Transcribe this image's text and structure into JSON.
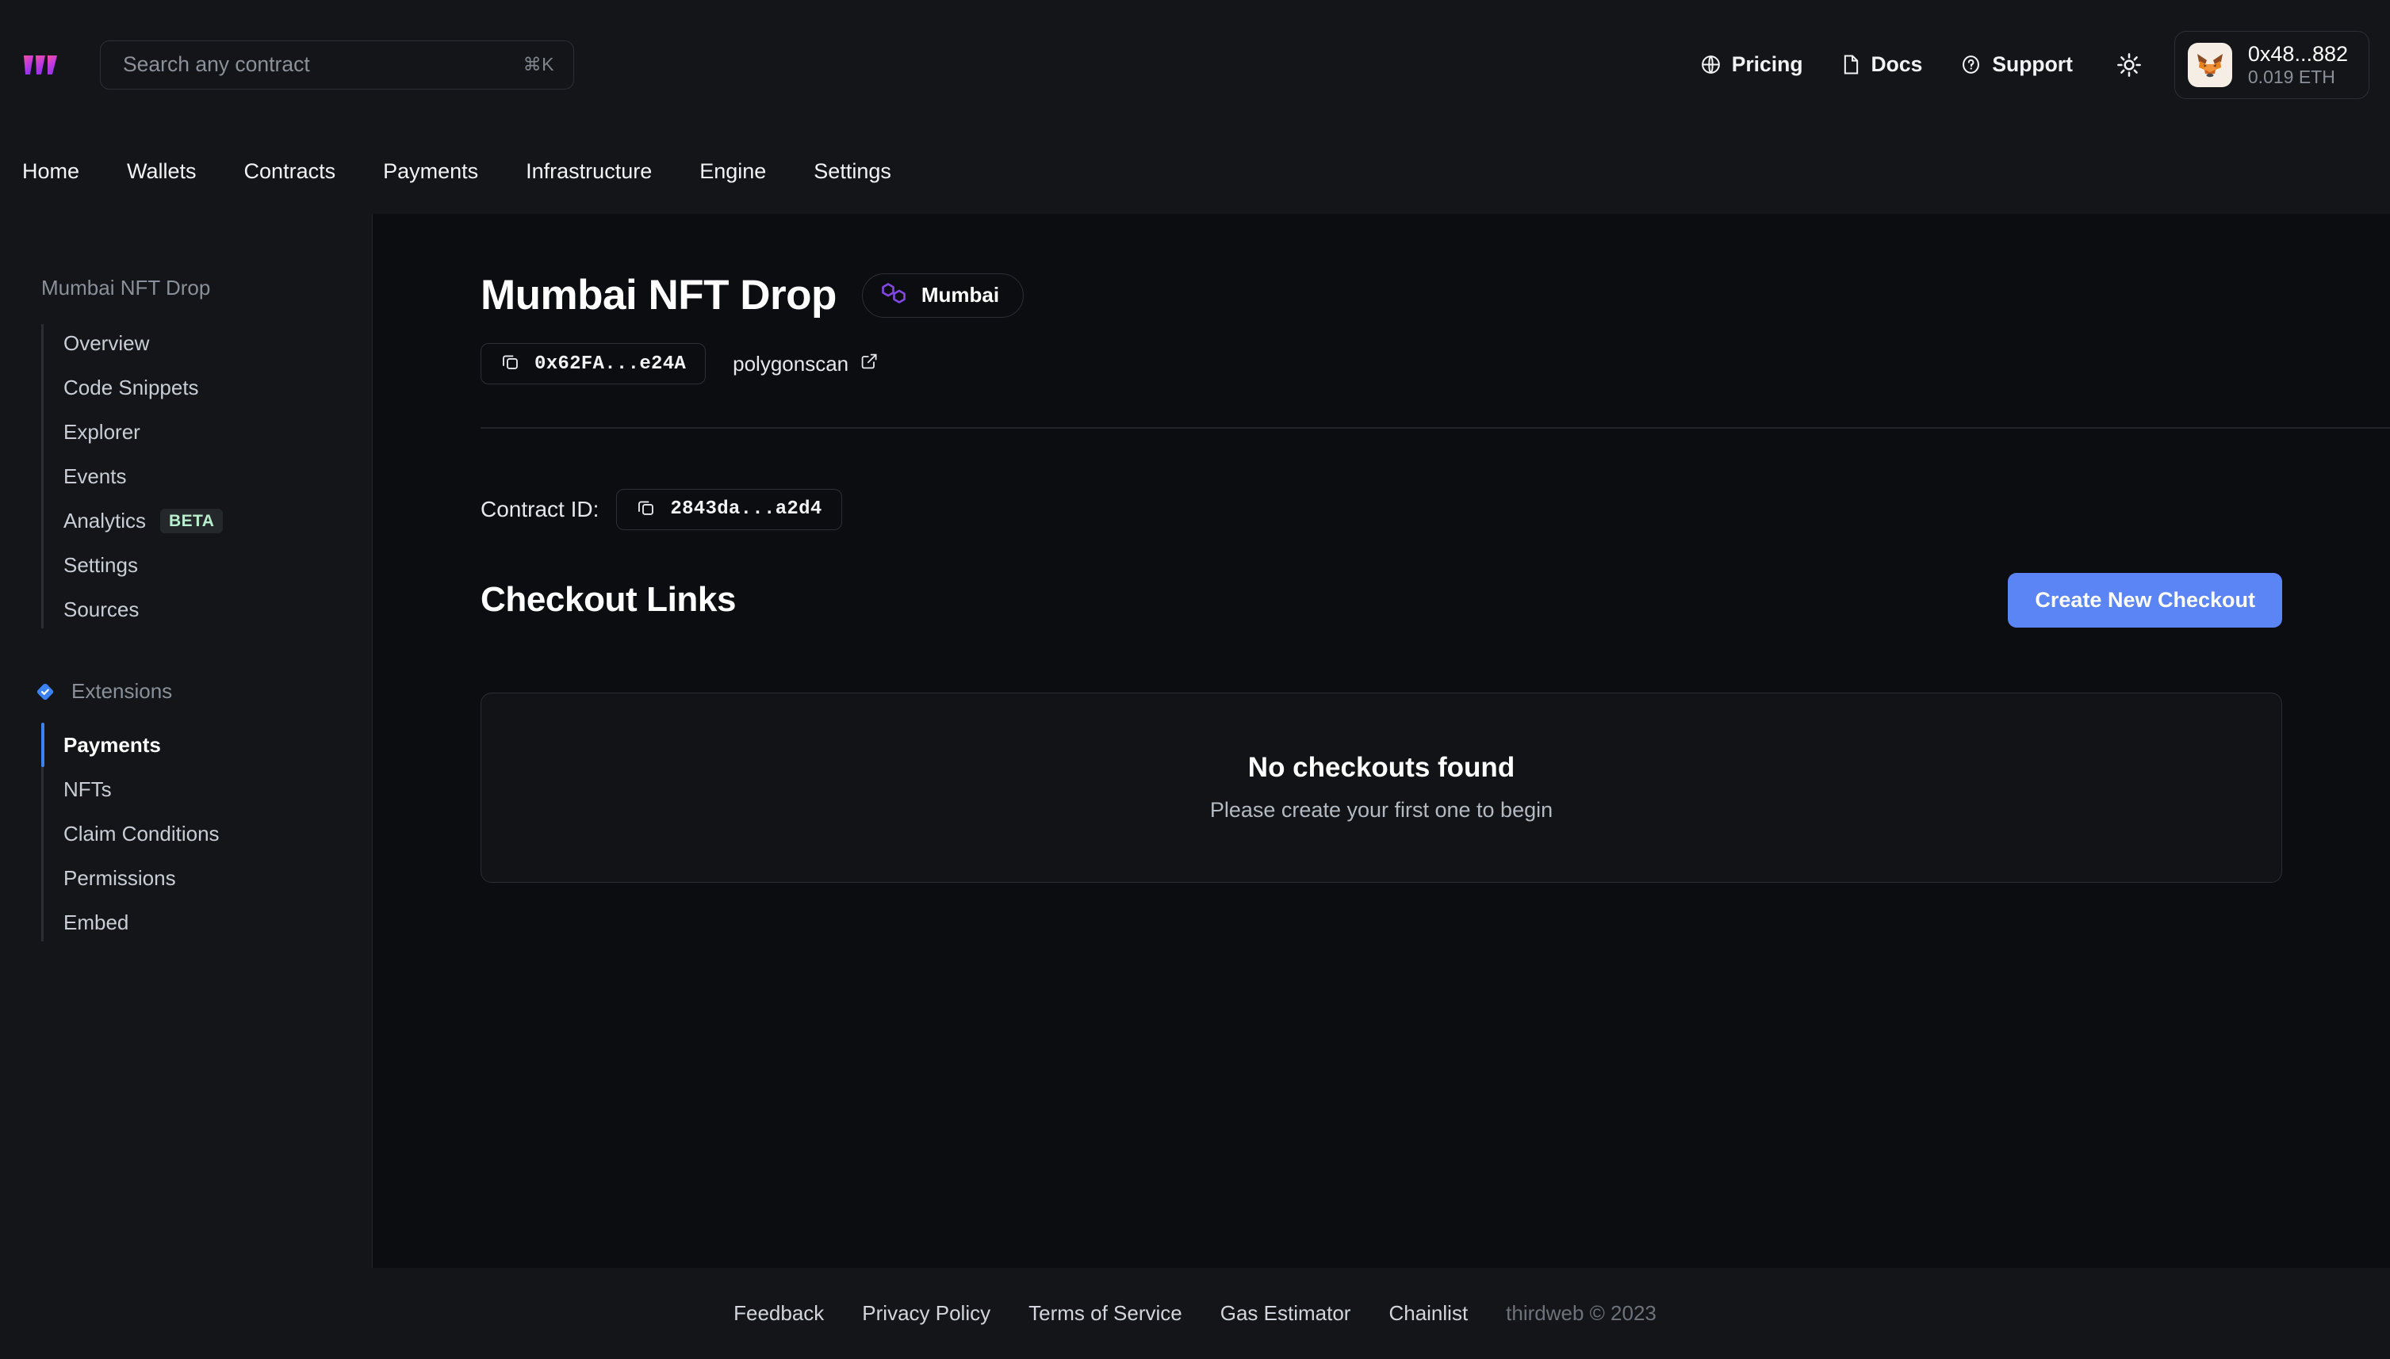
{
  "brand": {
    "logo_name": "thirdweb-logo",
    "accent_purple": "#a855f7",
    "accent_pink": "#e935c1"
  },
  "search": {
    "placeholder": "Search any contract",
    "value": "",
    "shortcut": "⌘K"
  },
  "topbar": {
    "links": [
      {
        "label": "Pricing",
        "icon": "globe-icon"
      },
      {
        "label": "Docs",
        "icon": "file-icon"
      },
      {
        "label": "Support",
        "icon": "question-circle-icon"
      }
    ],
    "theme_toggle_icon": "sun-icon",
    "wallet": {
      "address": "0x48...882",
      "balance": "0.019 ETH",
      "avatar_icon": "metamask-fox-avatar"
    }
  },
  "nav": {
    "items": [
      {
        "label": "Home"
      },
      {
        "label": "Wallets"
      },
      {
        "label": "Contracts"
      },
      {
        "label": "Payments"
      },
      {
        "label": "Infrastructure"
      },
      {
        "label": "Engine"
      },
      {
        "label": "Settings"
      }
    ]
  },
  "sidebar": {
    "title": "Mumbai NFT Drop",
    "items": [
      {
        "label": "Overview",
        "active": false
      },
      {
        "label": "Code Snippets",
        "active": false
      },
      {
        "label": "Explorer",
        "active": false
      },
      {
        "label": "Events",
        "active": false
      },
      {
        "label": "Analytics",
        "active": false,
        "badge": "BETA"
      },
      {
        "label": "Settings",
        "active": false
      },
      {
        "label": "Sources",
        "active": false
      }
    ],
    "extensions": {
      "label": "Extensions",
      "icon": "blue-check-diamond-icon",
      "items": [
        {
          "label": "Payments",
          "active": true
        },
        {
          "label": "NFTs",
          "active": false
        },
        {
          "label": "Claim Conditions",
          "active": false
        },
        {
          "label": "Permissions",
          "active": false
        },
        {
          "label": "Embed",
          "active": false
        }
      ]
    }
  },
  "contract": {
    "title": "Mumbai NFT Drop",
    "chain": {
      "name": "Mumbai",
      "icon": "polygon-icon",
      "color": "#8247e5"
    },
    "address": "0x62FA...e24A",
    "explorer_label": "polygonscan",
    "contract_id_label": "Contract ID:",
    "contract_id": "2843da...a2d4"
  },
  "checkout": {
    "section_title": "Checkout Links",
    "create_button": "Create New Checkout",
    "button_color": "#5b85f5",
    "empty_title": "No checkouts found",
    "empty_subtitle": "Please create your first one to begin"
  },
  "footer": {
    "links": [
      "Feedback",
      "Privacy Policy",
      "Terms of Service",
      "Gas Estimator",
      "Chainlist"
    ],
    "copyright": "thirdweb © 2023"
  }
}
